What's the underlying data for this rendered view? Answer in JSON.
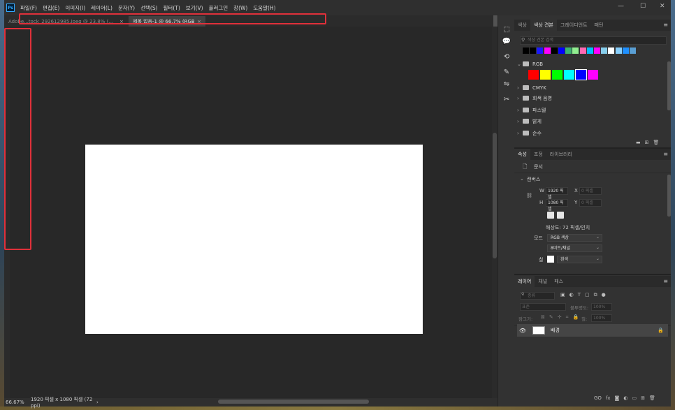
{
  "menubar": {
    "logo": "Ps",
    "items": [
      "파일(F)",
      "편집(E)",
      "이미지(I)",
      "레이어(L)",
      "문자(Y)",
      "선택(S)",
      "필터(T)",
      "보기(V)",
      "플러그인",
      "창(W)",
      "도움말(H)"
    ],
    "window_controls": [
      "—",
      "☐",
      "✕"
    ]
  },
  "tabs": [
    {
      "label": "Adobe...tock_292612985.jpeg @ 23.8% (배경, RGB/8) *",
      "close": "×",
      "active": false
    },
    {
      "label": "제목 없음-1 @ 66.7% (RGB/8)",
      "close": "×",
      "active": true
    }
  ],
  "status": {
    "zoom": "66.67%",
    "doc_info": "1920 픽셀 x 1080 픽셀 (72 ppi)",
    "arrow": "›"
  },
  "icon_strip": [
    "color-picker-icon",
    "comment-icon",
    "history-icon",
    "brush-icon",
    "adjust-icon",
    "tools-icon"
  ],
  "swatches_panel": {
    "tabs": [
      "색상",
      "색상 견본",
      "그레이디언트",
      "패턴"
    ],
    "active_tab": "색상 견본",
    "search_placeholder": "색상 견본 검색",
    "recent_colors": [
      "#000000",
      "#000000",
      "#1a1aff",
      "#ff00ff",
      "#000000",
      "#0000ff",
      "#3cb371",
      "#90ee90",
      "#ff69b4",
      "#00bfff",
      "#ff00ff",
      "#87ceeb",
      "#ffffff",
      "#87cefa",
      "#1e90ff",
      "#5a9fd4"
    ],
    "groups": [
      {
        "name": "RGB",
        "open": true,
        "colors": [
          "#ff0000",
          "#ffff00",
          "#00ff00",
          "#00ffff",
          "#0000ff",
          "#ff00ff"
        ]
      },
      {
        "name": "CMYK",
        "open": false
      },
      {
        "name": "회색 음영",
        "open": false
      },
      {
        "name": "파스텔",
        "open": false
      },
      {
        "name": "밝게",
        "open": false
      },
      {
        "name": "순수",
        "open": false
      }
    ]
  },
  "properties_panel": {
    "tabs": [
      "속성",
      "조정",
      "라이브러리"
    ],
    "active_tab": "속성",
    "doc_label": "문서",
    "section": "캔버스",
    "w_label": "W",
    "w_value": "1920 픽셀",
    "h_label": "H",
    "h_value": "1080 픽셀",
    "x_label": "X",
    "x_placeholder": "0 픽셀",
    "y_label": "Y",
    "y_placeholder": "0 픽셀",
    "resolution": "해상도: 72 픽셀/인치",
    "mode_label": "모드",
    "mode_value": "RGB 색상",
    "depth_value": "8비트/채널",
    "fill_label": "칠",
    "fill_value": "흰색"
  },
  "layers_panel": {
    "tabs": [
      "레이어",
      "채널",
      "패스"
    ],
    "active_tab": "레이어",
    "filter_placeholder": "종류",
    "blend_mode": "표준",
    "opacity_label": "불투명도:",
    "opacity_value": "100%",
    "lock_label": "잠그기:",
    "fill_label": "칠:",
    "fill_value": "100%",
    "layers": [
      {
        "name": "배경",
        "visible": true,
        "locked": true
      }
    ],
    "bottom_icons": [
      "GO",
      "fx",
      "◙",
      "◐",
      "▭",
      "⊞",
      "🗑"
    ]
  },
  "colors": {
    "highlight": "#e0303a",
    "canvas_bg": "#282828",
    "panel_bg": "#323232"
  }
}
